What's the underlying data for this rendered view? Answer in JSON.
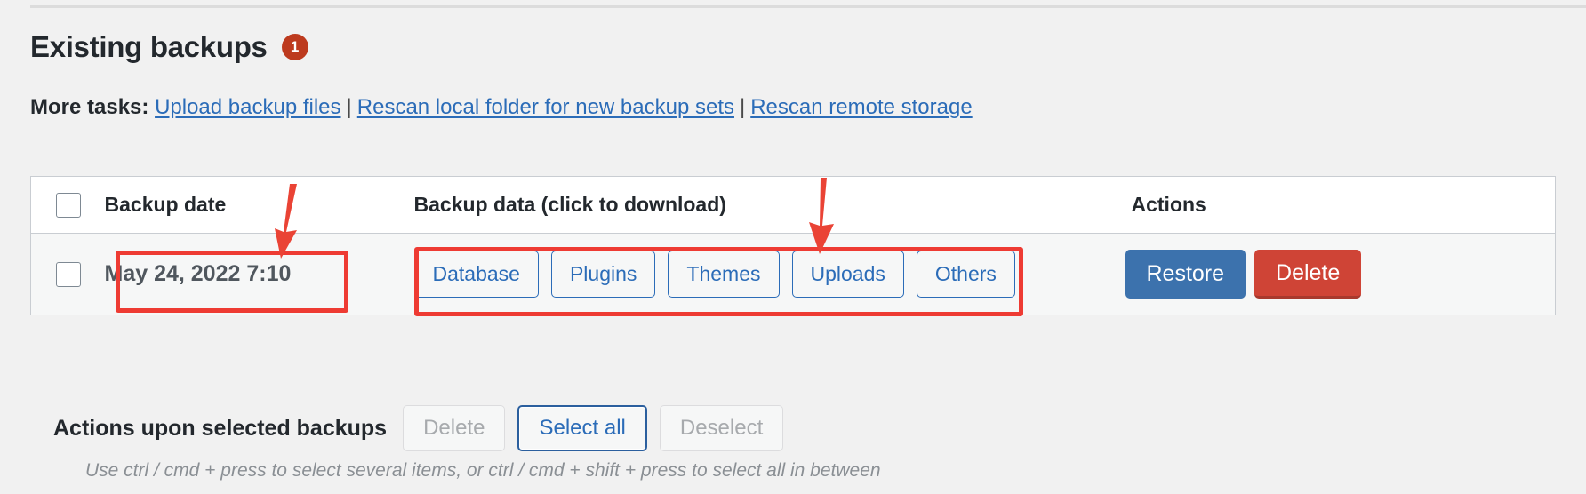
{
  "heading": {
    "title": "Existing backups",
    "badge_count": "1"
  },
  "more_tasks": {
    "label": "More tasks:",
    "separator": "|",
    "links": [
      {
        "text": "Upload backup files"
      },
      {
        "text": "Rescan local folder for new backup sets"
      },
      {
        "text": "Rescan remote storage"
      }
    ]
  },
  "table": {
    "headers": {
      "select_all_checkbox": "select-all-checkbox",
      "backup_date": "Backup date",
      "backup_data": "Backup data (click to download)",
      "actions": "Actions"
    },
    "rows": [
      {
        "date": "May 24, 2022 7:10",
        "data_buttons": [
          {
            "label": "Database"
          },
          {
            "label": "Plugins"
          },
          {
            "label": "Themes"
          },
          {
            "label": "Uploads"
          },
          {
            "label": "Others"
          }
        ],
        "actions": [
          {
            "label": "Restore",
            "kind": "primary"
          },
          {
            "label": "Delete",
            "kind": "danger"
          }
        ]
      }
    ]
  },
  "bottom": {
    "label": "Actions upon selected backups",
    "buttons": [
      {
        "label": "Delete",
        "state": "disabled"
      },
      {
        "label": "Select all",
        "state": "focused"
      },
      {
        "label": "Deselect",
        "state": "disabled"
      }
    ],
    "hint": "Use ctrl / cmd + press to select several items, or ctrl / cmd + shift + press to select all in between"
  },
  "colors": {
    "badge": "#bd3a1e",
    "link": "#2b6cb8",
    "restore_button": "#3c72ad",
    "delete_button": "#cf4436",
    "annotation": "#ee3b33",
    "page_background": "#f1f1f1",
    "table_row_background": "#f6f7f7"
  }
}
